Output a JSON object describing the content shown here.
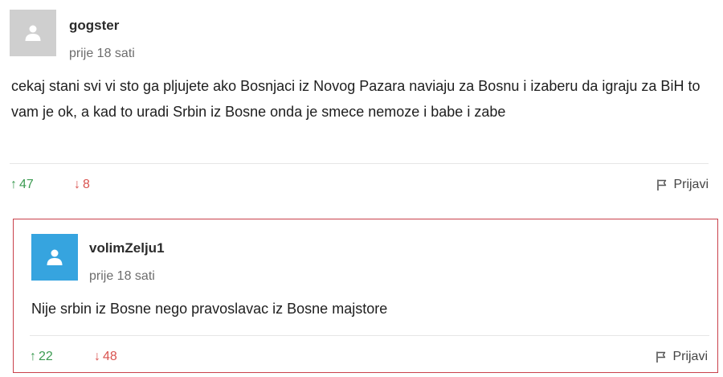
{
  "comments": [
    {
      "username": "gogster",
      "time": "prije 18 sati",
      "text": "cekaj stani svi vi sto ga pljujete ako Bosnjaci iz Novog Pazara naviaju za Bosnu i izaberu da igraju za BiH to vam je ok, a kad to uradi Srbin iz Bosne onda je smece nemoze i babe i zabe",
      "upvotes": "47",
      "downvotes": "8",
      "report_label": "Prijavi",
      "avatar_color": "#cfcfcf"
    },
    {
      "username": "volimZelju1",
      "time": "prije 18 sati",
      "text": "Nije srbin iz Bosne nego pravoslavac iz Bosne majstore",
      "upvotes": "22",
      "downvotes": "48",
      "report_label": "Prijavi",
      "avatar_color": "#36a4df"
    }
  ],
  "icons": {
    "avatar": "user-silhouette-icon",
    "upvote": "arrow-up-icon",
    "downvote": "arrow-down-icon",
    "report": "flag-icon"
  },
  "colors": {
    "upvote": "#3c9b52",
    "downvote": "#d9534f",
    "highlight_border": "#c9404a"
  },
  "glyphs": {
    "up_arrow": "↑",
    "down_arrow": "↓"
  }
}
